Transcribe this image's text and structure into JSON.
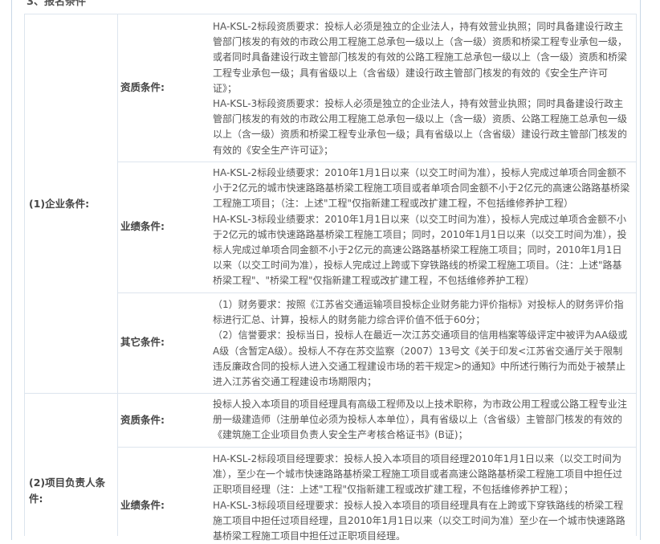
{
  "section_title": "3、报名条件",
  "groups": [
    {
      "label": "(1)企业条件:",
      "rows": [
        {
          "label": "资质条件:",
          "text": "HA-KSL-2标段资质要求：投标人必须是独立的企业法人，持有效营业执照；同时具备建设行政主管部门核发的有效的市政公用工程施工总承包一级以上（含一级）资质和桥梁工程专业承包一级，或者同时具备建设行政主管部门核发的有效的公路工程施工总承包一级以上（含一级）资质和桥梁工程专业承包一级；具有省级以上（含省级）建设行政主管部门核发的有效的《安全生产许可证》；\nHA-KSL-3标段资质要求：投标人必须是独立的企业法人，持有效营业执照；同时具备建设行政主管部门核发的有效的市政公用工程施工总承包一级以上（含一级）资质、公路工程施工总承包一级以上（含一级）资质和桥梁工程专业承包一级；具有省级以上（含省级）建设行政主管部门核发的有效的《安全生产许可证》；"
        },
        {
          "label": "业绩条件:",
          "text": "HA-KSL-2标段业绩要求：2010年1月1日以来（以交工时间为准），投标人完成过单项合同金额不小于2亿元的城市快速路路基桥梁工程施工项目或者单项合同金额不小于2亿元的高速公路路基桥梁工程施工项目；（注：上述\"工程\"仅指新建工程或改扩建工程，不包括维修养护工程）\nHA-KSL-3标段业绩要求：2010年1月1日以来（以交工时间为准），投标人完成过单项合金额不小于2亿元的城市快速路路基桥梁工程施工项目；同时，2010年1月1日以来（以交工时间为准），投标人完成过单项合同金额不小于2亿元的高速公路路基桥梁工程施工项目；同时，2010年1月1日以来（以交工时间为准），投标人完成过上跨或下穿铁路线的桥梁工程施工项目。（注：上述\"路基桥梁工程\"、\"桥梁工程\"仅指新建工程或改扩建工程，不包括维修养护工程）"
        },
        {
          "label": "其它条件:",
          "text": "（1）财务要求：按照《江苏省交通运输项目投标企业财务能力评价指标》对投标人的财务评价指标进行汇总、计算，投标人的财务能力综合评价值不低于60分；\n（2）信誉要求：投标当日，投标人在最近一次江苏交通项目的信用档案等级评定中被评为AA级或A级（含暂定A级）。投标人不存在苏交监察（2007）13号文《关于印发<江苏省交通厅关于限制违反廉政合同的投标人进入交通工程建设市场的若干规定>的通知》中所述行贿行为而处于被禁止进入江苏省交通工程建设市场期限内；"
        }
      ]
    },
    {
      "label": "(2)项目负责人条件:",
      "rows": [
        {
          "label": "资质条件:",
          "text": "投标人投入本项目的项目经理具有高级工程师及以上技术职称，为市政公用工程或公路工程专业注册一级建造师（注册单位必须为投标人本单位），具有省级以上（含省级）主管部门核发的有效的《建筑施工企业项目负责人安全生产考核合格证书》(B证)；"
        },
        {
          "label": "业绩条件:",
          "text": "HA-KSL-2标段项目经理要求：投标人投入本项目的项目经理2010年1月1日以来（以交工时间为准），至少在一个城市快速路路基桥梁工程施工项目或者高速公路路基桥梁工程施工项目中担任过正职项目经理（注：上述\"工程\"仅指新建工程或改扩建工程，不包括维修养护工程）；\nHA-KSL-3标段项目经理要求：投标人投入本项目的项目经理具有在上跨或下穿铁路线的桥梁工程施工项目中担任过项目经理，且2010年1月1日以来（以交工时间为准）至少在一个城市快速路路基桥梁工程施工项目中担任过正职项目经理。"
        }
      ]
    }
  ]
}
